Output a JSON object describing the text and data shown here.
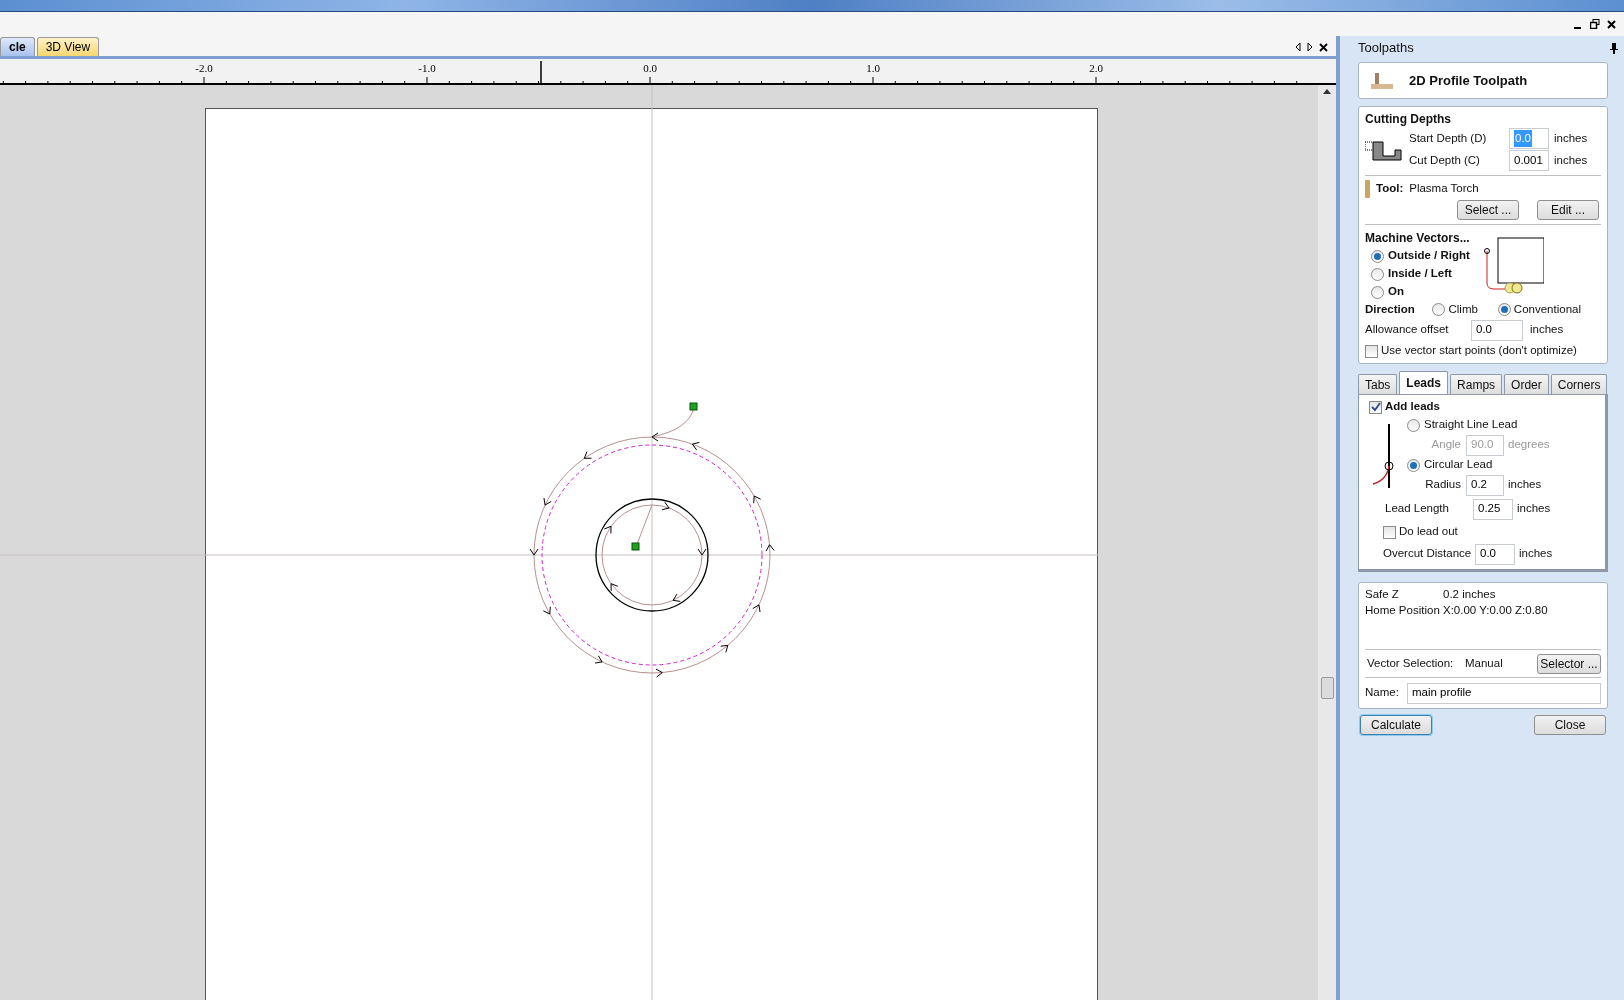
{
  "view_tabs": [
    {
      "label": "cle",
      "selected": true
    },
    {
      "label": "3D View",
      "selected": false
    }
  ],
  "ruler": {
    "labels": [
      "-2.0",
      "-1.0",
      "0.0",
      "1.0",
      "2.0"
    ]
  },
  "panel": {
    "title": "Toolpaths",
    "header": "2D Profile Toolpath",
    "cutting_depths": {
      "title": "Cutting Depths",
      "fields": [
        {
          "label": "Start Depth (D)",
          "value": "0.0",
          "unit": "inches",
          "text_selected": true
        },
        {
          "label": "Cut Depth (C)",
          "value": "0.001",
          "unit": "inches",
          "text_selected": false
        }
      ]
    },
    "tool": {
      "label": "Tool:",
      "name": "Plasma Torch",
      "buttons": [
        "Select ...",
        "Edit ..."
      ]
    },
    "machine_vectors": {
      "title": "Machine Vectors...",
      "options": [
        {
          "label": "Outside / Right",
          "selected": true
        },
        {
          "label": "Inside / Left",
          "selected": false
        },
        {
          "label": "On",
          "selected": false
        }
      ]
    },
    "direction": {
      "label": "Direction",
      "options": [
        {
          "label": "Climb",
          "selected": false
        },
        {
          "label": "Conventional",
          "selected": true
        }
      ]
    },
    "allowance": {
      "label": "Allowance offset",
      "value": "0.0",
      "unit": "inches"
    },
    "vector_start": {
      "label": "Use vector start points (don't optimize)",
      "checked": false
    },
    "tabs": [
      {
        "label": "Tabs",
        "selected": false
      },
      {
        "label": "Leads",
        "selected": true
      },
      {
        "label": "Ramps",
        "selected": false
      },
      {
        "label": "Order",
        "selected": false
      },
      {
        "label": "Corners",
        "selected": false
      }
    ],
    "leads": {
      "add_leads": {
        "label": "Add leads",
        "checked": true
      },
      "lead_types": [
        {
          "label": "Straight Line Lead",
          "selected": false,
          "field": {
            "label": "Angle",
            "value": "90.0",
            "unit": "degrees",
            "disabled": true
          }
        },
        {
          "label": "Circular Lead",
          "selected": true,
          "field": {
            "label": "Radius",
            "value": "0.2",
            "unit": "inches",
            "disabled": false
          }
        }
      ],
      "lead_length": {
        "label": "Lead Length",
        "value": "0.25",
        "unit": "inches"
      },
      "lead_out": {
        "label": "Do lead out",
        "checked": false
      },
      "overcut": {
        "label": "Overcut Distance",
        "value": "0.0",
        "unit": "inches"
      }
    },
    "summary": {
      "rows": [
        {
          "label": "Safe Z",
          "value": "0.2 inches"
        },
        {
          "label": "Home Position",
          "value": "X:0.00 Y:0.00 Z:0.80"
        }
      ],
      "vector_selection": {
        "label": "Vector Selection:",
        "value": "Manual",
        "button": "Selector ..."
      },
      "name": {
        "label": "Name:",
        "value": "main profile"
      }
    },
    "buttons": [
      "Calculate",
      "Close"
    ]
  }
}
